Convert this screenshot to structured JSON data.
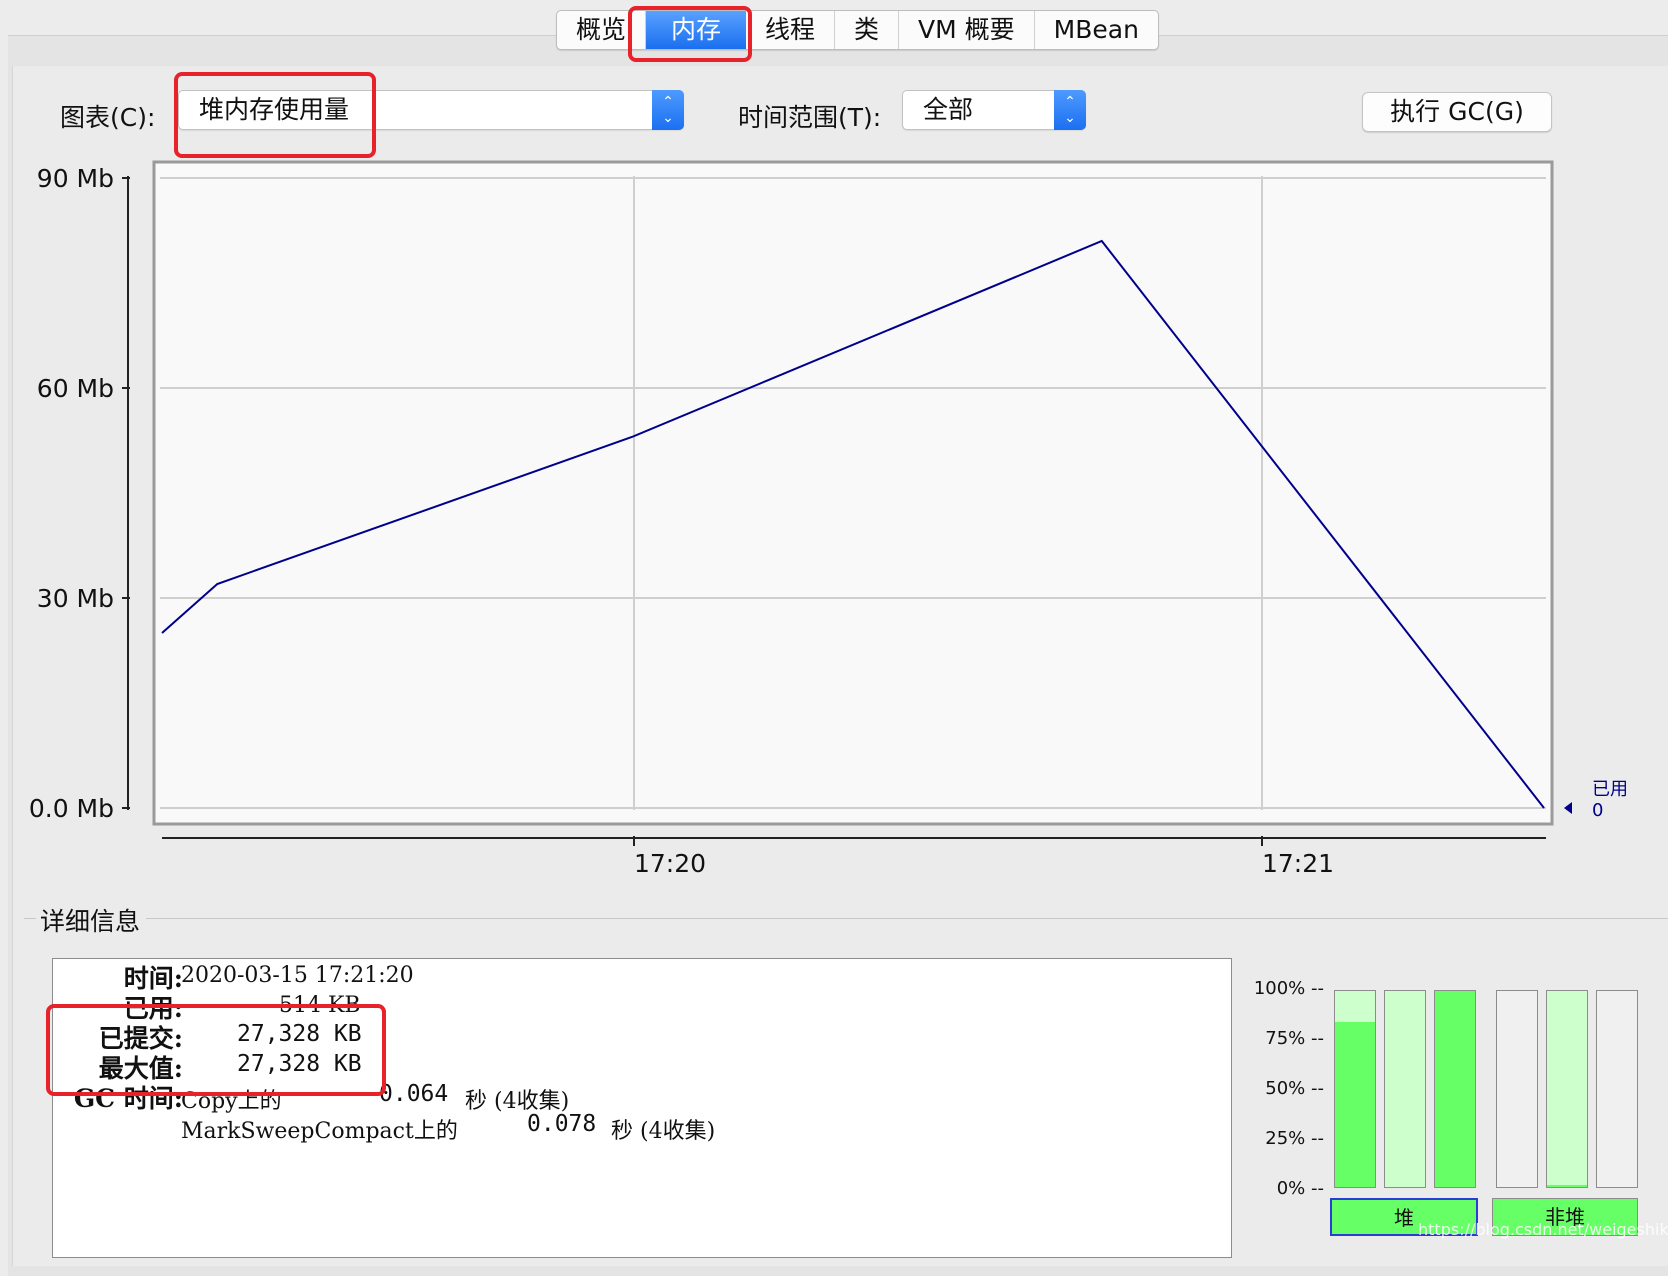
{
  "tabs": [
    {
      "label": "概览",
      "active": false
    },
    {
      "label": "内存",
      "active": true
    },
    {
      "label": "线程",
      "active": false
    },
    {
      "label": "类",
      "active": false
    },
    {
      "label": "VM 概要",
      "active": false
    },
    {
      "label": "MBean",
      "active": false
    }
  ],
  "controls": {
    "chart_label": "图表(C):",
    "chart_value": "堆内存使用量",
    "range_label": "时间范围(T):",
    "range_value": "全部",
    "gc_button": "执行 GC(G)"
  },
  "chart_data": {
    "type": "line",
    "y_ticks": [
      "90 Mb",
      "60 Mb",
      "30 Mb",
      "0.0 Mb"
    ],
    "y_tick_values": [
      90,
      60,
      30,
      0
    ],
    "ylim": [
      0,
      90
    ],
    "x_ticks": [
      "17:20",
      "17:21"
    ],
    "series": [
      {
        "name": "已用",
        "current_value": "0",
        "color": "#00008b",
        "points": [
          [
            0,
            25
          ],
          [
            0.04,
            32
          ],
          [
            0.34,
            53
          ],
          [
            0.68,
            81
          ],
          [
            1.0,
            0
          ]
        ]
      }
    ],
    "grid": true
  },
  "details": {
    "title": "详细信息",
    "time_label": "时间:",
    "time_value": "2020-03-15 17:21:20",
    "used_label": "已用:",
    "used_value": "514 KB",
    "committed_label": "已提交:",
    "committed_value": "27,328 KB",
    "max_label": "最大值:",
    "max_value": "27,328 KB",
    "gc_label": "GC 时间:",
    "gc1_name": "Copy上的",
    "gc1_time": "0.064",
    "gc1_unit": "秒 (4收集)",
    "gc2_name": "MarkSweepCompact上的",
    "gc2_time": "0.078",
    "gc2_unit": "秒 (4收集)"
  },
  "pools": {
    "pct_labels": [
      "100% --",
      "75% --",
      "50% --",
      "25% --",
      "0% --"
    ],
    "heap_bars": [
      0.84,
      0,
      1.0
    ],
    "nonheap_bars": [
      0,
      0.01,
      0
    ],
    "heap_button": "堆",
    "nonheap_button": "非堆",
    "fill_color": "#66ff66",
    "empty_color": "#ccffcc"
  },
  "watermark": "https://blog.csdn.net/weigeshikebi"
}
